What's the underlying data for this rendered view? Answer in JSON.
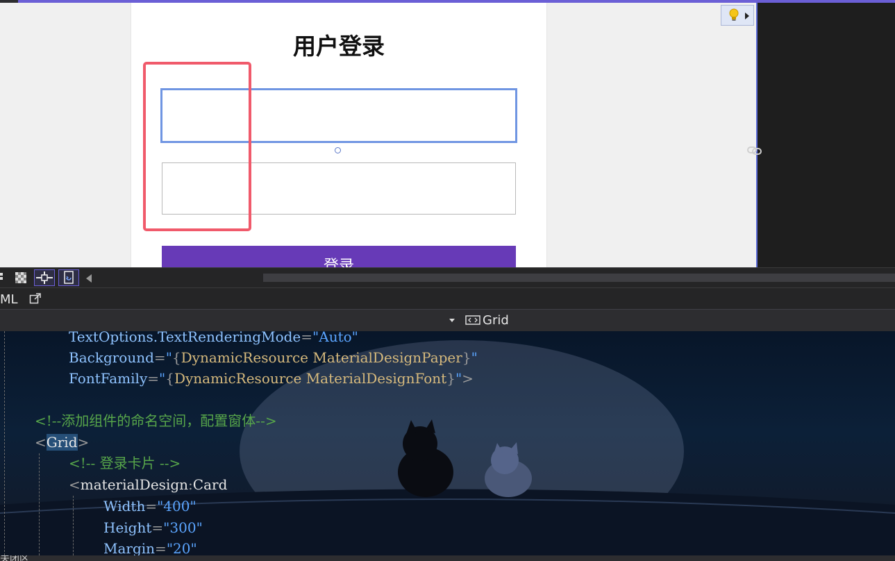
{
  "designer": {
    "card_title": "用户登录",
    "login_button_label": "登录",
    "username_value": "",
    "password_value": ""
  },
  "toolbar": {
    "buttons": [
      "grid-toggle",
      "checker-toggle",
      "snap-toggle",
      "refresh-designer"
    ]
  },
  "tab": {
    "xaml_label": "ML"
  },
  "nav": {
    "element_name": "Grid"
  },
  "code": {
    "line1": {
      "attr": "TextOptions.TextRenderingMode",
      "eq": "=",
      "q1": "\"",
      "value": "Auto",
      "q2": "\""
    },
    "line2": {
      "attr": "Background",
      "eq": "=",
      "q1": "\"",
      "open": "{",
      "ext": "DynamicResource",
      "key": "MaterialDesignPaper",
      "close": "}",
      "q2": "\""
    },
    "line3": {
      "attr": "FontFamily",
      "eq": "=",
      "q1": "\"",
      "open": "{",
      "ext": "DynamicResource",
      "key": "MaterialDesignFont",
      "close": "}",
      "q2": "\"",
      "end": ">"
    },
    "line5": {
      "comment": "<!--添加组件的命名空间，配置窗体-->"
    },
    "line6": {
      "lt": "<",
      "tag": "Grid",
      "gt": ">"
    },
    "line7": {
      "comment": "<!-- 登录卡片 -->"
    },
    "line8": {
      "lt": "<",
      "prefix": "materialDesign",
      "colon": ":",
      "tag": "Card"
    },
    "line9": {
      "attr": "Width",
      "eq": "=",
      "q1": "\"",
      "value": "400",
      "q2": "\""
    },
    "line10": {
      "attr": "Height",
      "eq": "=",
      "q1": "\"",
      "value": "300",
      "q2": "\""
    },
    "line11": {
      "attr": "Margin",
      "eq": "=",
      "q1": "\"",
      "value": "20",
      "q2": "\""
    }
  },
  "status": {
    "bottom_label": "关闭区"
  },
  "colors": {
    "accent": "#6b5fd6",
    "button_purple": "#673ab7",
    "highlight": "#f05a6b",
    "selection_border": "#6f95e2"
  }
}
